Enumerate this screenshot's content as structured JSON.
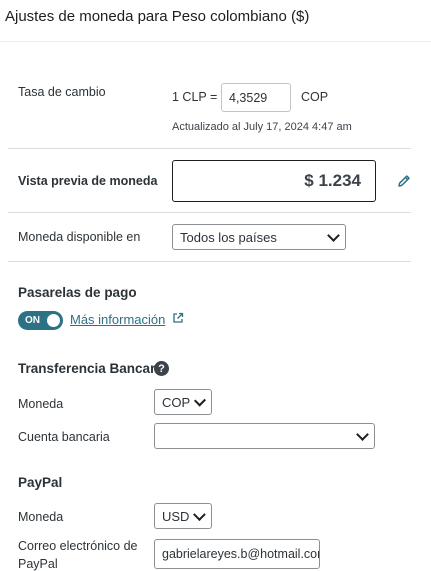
{
  "header": {
    "title": "Ajustes de moneda para Peso colombiano ($)"
  },
  "exchange": {
    "label": "Tasa de cambio",
    "prefix": "1 CLP =",
    "rate": "4,3529",
    "suffix": "COP",
    "updated": "Actualizado al July 17, 2024 4:47 am"
  },
  "preview": {
    "label": "Vista previa de moneda",
    "value": "$ 1.234"
  },
  "availability": {
    "label": "Moneda disponible en",
    "selected": "Todos los países"
  },
  "gateways": {
    "title": "Pasarelas de pago",
    "toggle_label": "ON",
    "more_info": "Más información"
  },
  "bank_transfer": {
    "title": "Transferencia Bancaria",
    "help": "?",
    "currency_label": "Moneda",
    "currency_value": "COP",
    "account_label": "Cuenta bancaria",
    "account_value": ""
  },
  "paypal": {
    "title": "PayPal",
    "currency_label": "Moneda",
    "currency_value": "USD",
    "email_label_1": "Correo electrónico de",
    "email_label_2": "PayPal",
    "email_value": "gabrielareyes.b@hotmail.com"
  },
  "colors": {
    "accent": "#2c7186",
    "border": "#8c8f94",
    "text": "#1e1e1e"
  },
  "icons": {
    "edit": "pencil-icon",
    "external": "external-link-icon",
    "help": "help-icon",
    "dropdown": "chevron-down-icon"
  }
}
